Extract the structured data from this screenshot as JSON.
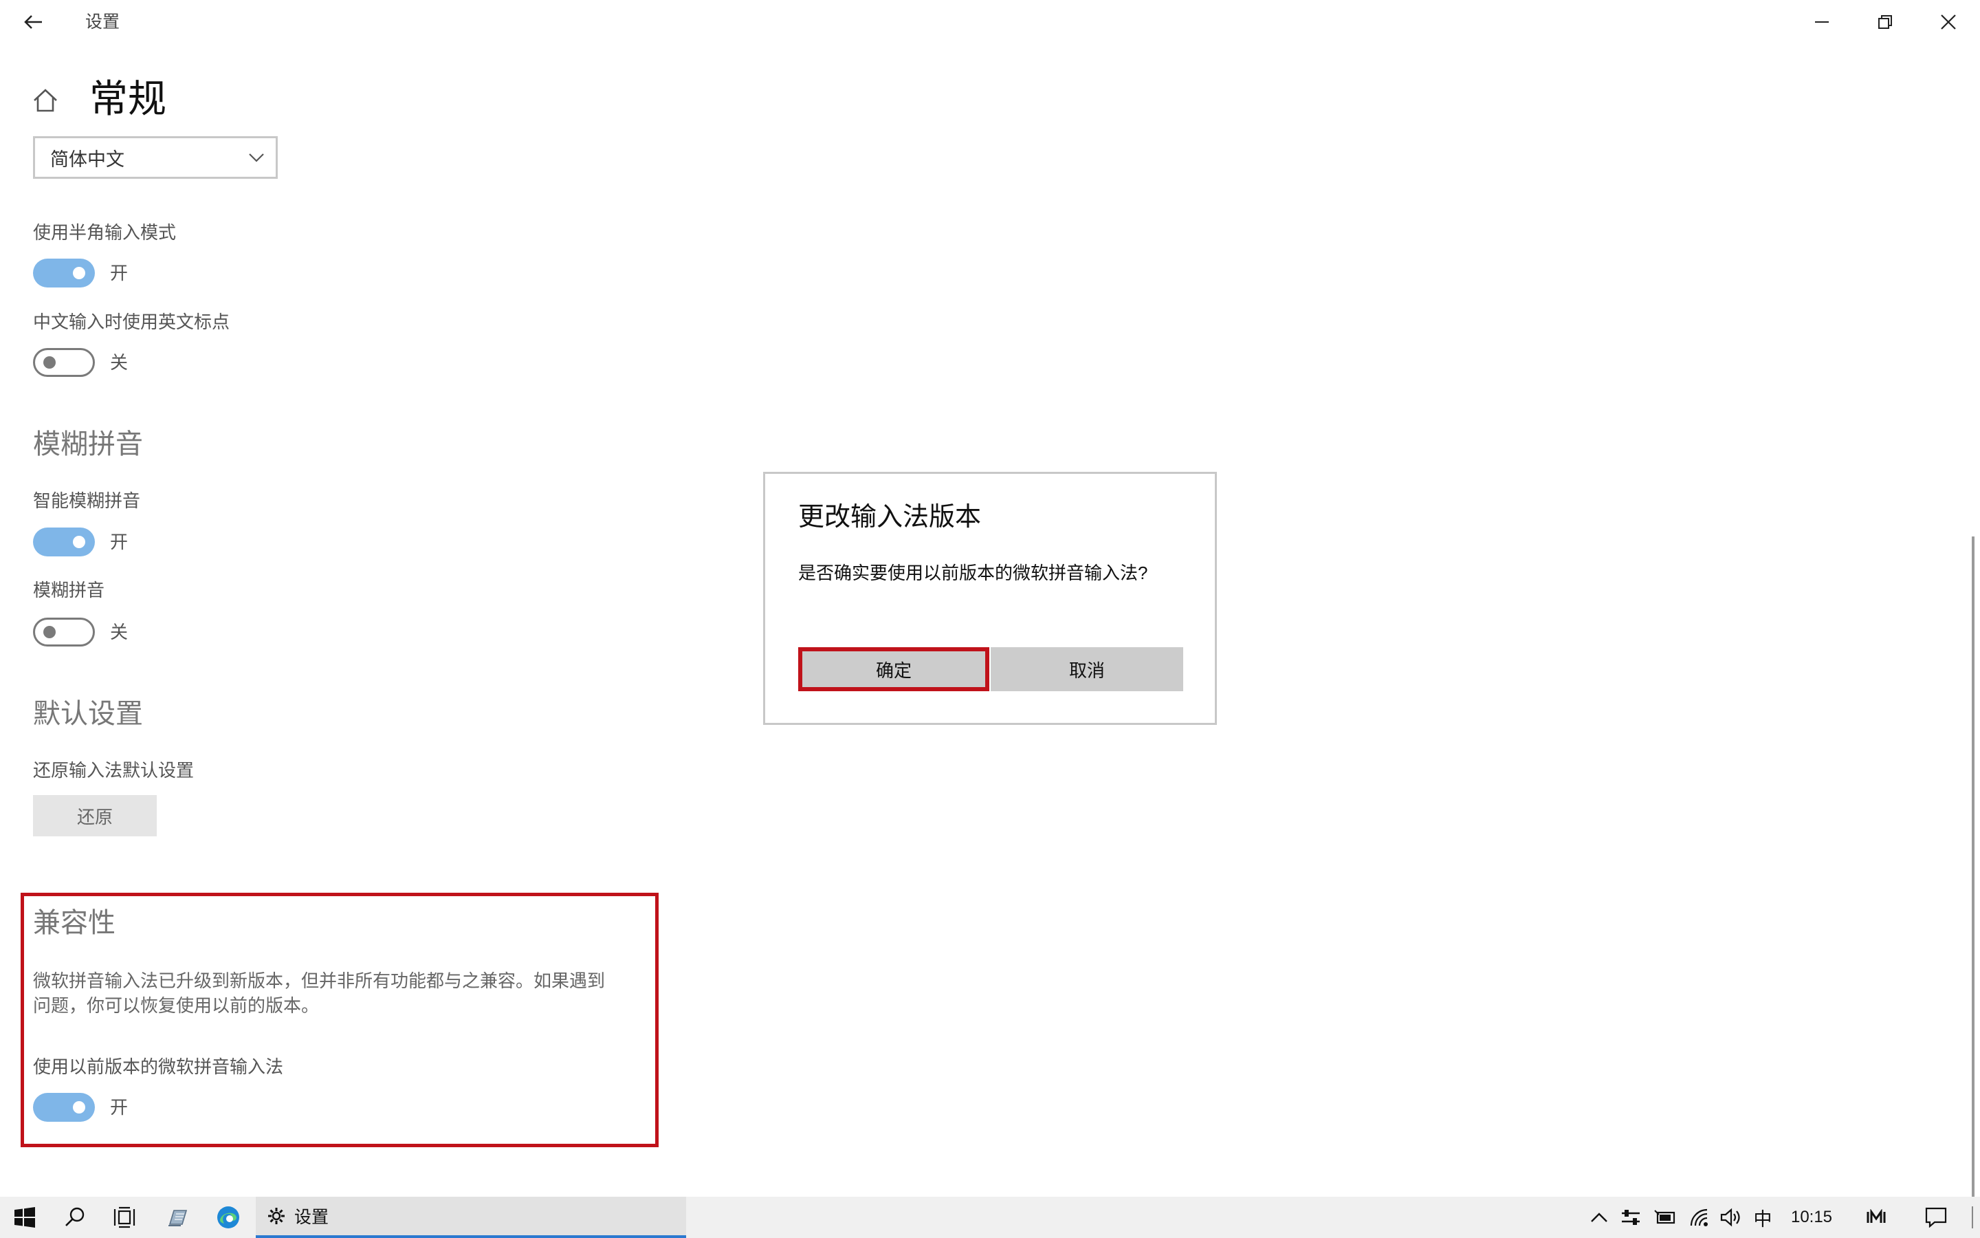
{
  "window": {
    "title": "设置"
  },
  "page": {
    "title": "常规",
    "language_select": {
      "value": "简体中文"
    }
  },
  "settings": [
    {
      "label": "使用半角输入模式",
      "state": "开",
      "on": true
    },
    {
      "label": "中文输入时使用英文标点",
      "state": "关",
      "on": false
    }
  ],
  "fuzzy": {
    "heading": "模糊拼音",
    "items": [
      {
        "label": "智能模糊拼音",
        "state": "开",
        "on": true
      },
      {
        "label": "模糊拼音",
        "state": "关",
        "on": false
      }
    ]
  },
  "defaults": {
    "heading": "默认设置",
    "label": "还原输入法默认设置",
    "button": "还原"
  },
  "compat": {
    "heading": "兼容性",
    "desc_line1": "微软拼音输入法已升级到新版本，但并非所有功能都与之兼容。如果遇到",
    "desc_line2": "问题，你可以恢复使用以前的版本。",
    "toggle_label": "使用以前版本的微软拼音输入法",
    "state": "开",
    "on": true
  },
  "dialog": {
    "title": "更改输入法版本",
    "message": "是否确实要使用以前版本的微软拼音输入法?",
    "ok": "确定",
    "cancel": "取消"
  },
  "taskbar": {
    "settings_label": "设置",
    "ime_indicator": "中",
    "time": "10:15"
  },
  "colors": {
    "toggle_on": "#7fb6e8",
    "highlight": "#c0121a",
    "taskbar_accent": "#2b79d0"
  }
}
